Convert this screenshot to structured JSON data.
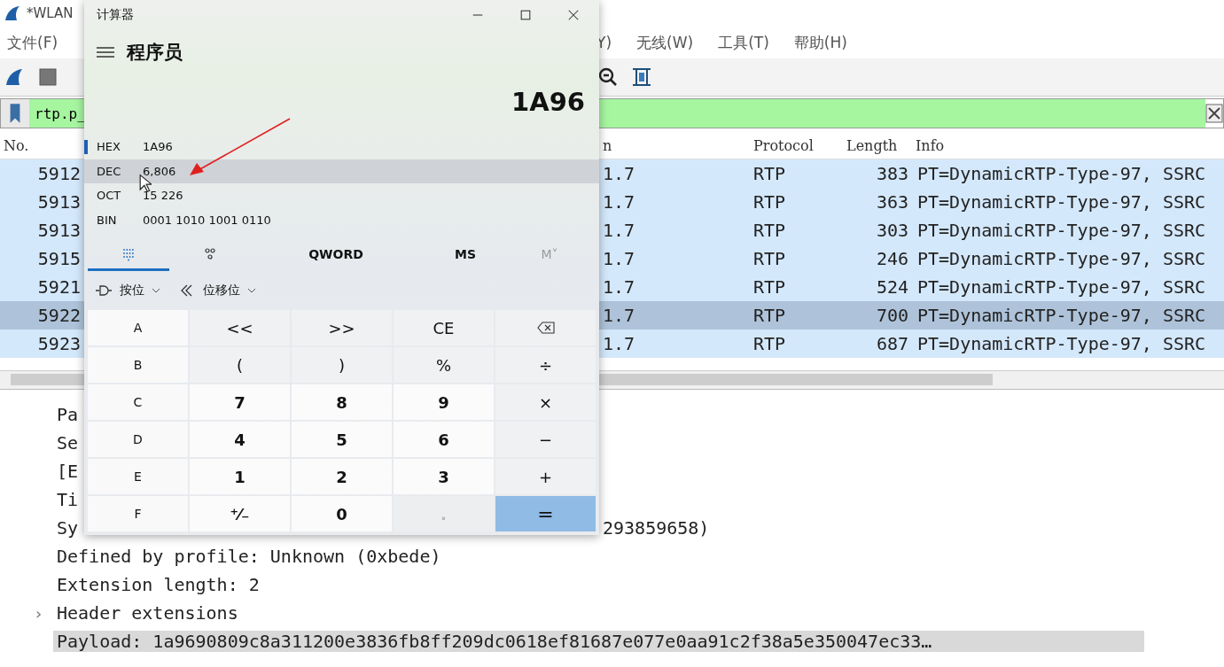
{
  "wireshark": {
    "title": "*WLAN",
    "menu_left": [
      "文件(F)"
    ],
    "menu_right": [
      "Y)",
      "无线(W)",
      "工具(T)",
      "帮助(H)"
    ],
    "filter": {
      "value": "rtp.p_"
    },
    "columns": {
      "no": "No.",
      "dest": "n",
      "protocol": "Protocol",
      "length": "Length",
      "info": "Info"
    },
    "rows": [
      {
        "no": "5912",
        "dest": "1.7",
        "protocol": "RTP",
        "length": "383",
        "info": "PT=DynamicRTP-Type-97, SSRC",
        "selected": false
      },
      {
        "no": "5913",
        "dest": "1.7",
        "protocol": "RTP",
        "length": "363",
        "info": "PT=DynamicRTP-Type-97, SSRC",
        "selected": false
      },
      {
        "no": "5913",
        "dest": "1.7",
        "protocol": "RTP",
        "length": "303",
        "info": "PT=DynamicRTP-Type-97, SSRC",
        "selected": false
      },
      {
        "no": "5915",
        "dest": "1.7",
        "protocol": "RTP",
        "length": "246",
        "info": "PT=DynamicRTP-Type-97, SSRC",
        "selected": false
      },
      {
        "no": "5921",
        "dest": "1.7",
        "protocol": "RTP",
        "length": "524",
        "info": "PT=DynamicRTP-Type-97, SSRC",
        "selected": false
      },
      {
        "no": "5922",
        "dest": "1.7",
        "protocol": "RTP",
        "length": "700",
        "info": "PT=DynamicRTP-Type-97, SSRC",
        "selected": true
      },
      {
        "no": "5923",
        "dest": "1.7",
        "protocol": "RTP",
        "length": "687",
        "info": "PT=DynamicRTP-Type-97, SSRC",
        "selected": false
      }
    ],
    "details": [
      {
        "text": "Pa",
        "selected": false
      },
      {
        "text": "Se",
        "selected": false
      },
      {
        "text": "[E",
        "selected": false
      },
      {
        "text": "Ti",
        "selected": false
      },
      {
        "text": "Sy",
        "tail": "293859658)",
        "selected": false
      },
      {
        "text": "Defined by profile: Unknown (0xbede)",
        "selected": false
      },
      {
        "text": "Extension length: 2",
        "selected": false
      },
      {
        "text": "Header extensions",
        "expander": "›",
        "selected": false
      },
      {
        "text": "Payload: 1a9690809c8a311200e3836fb8ff209dc0618ef81687e077e0aa91c2f38a5e350047ec33…",
        "selected": true
      }
    ]
  },
  "calculator": {
    "title": "计算器",
    "mode": "程序员",
    "display": "1A96",
    "radix": [
      {
        "label": "HEX",
        "value": "1A96",
        "selected": true,
        "hovered": false
      },
      {
        "label": "DEC",
        "value": "6,806",
        "selected": false,
        "hovered": true
      },
      {
        "label": "OCT",
        "value": "15 226",
        "selected": false,
        "hovered": false
      },
      {
        "label": "BIN",
        "value": "0001 1010 1001 0110",
        "selected": false,
        "hovered": false
      }
    ],
    "tabs": [
      {
        "kind": "keypad",
        "selected": true,
        "disabled": false
      },
      {
        "kind": "bits",
        "selected": false,
        "disabled": false
      },
      {
        "kind": "text",
        "label": "QWORD",
        "selected": false,
        "disabled": false
      },
      {
        "kind": "text",
        "label": "MS",
        "selected": false,
        "disabled": false
      },
      {
        "kind": "text",
        "label": "M˅",
        "selected": false,
        "disabled": true
      }
    ],
    "dropdowns": [
      {
        "kind": "bitwise",
        "label": "按位"
      },
      {
        "kind": "shift",
        "label": "位移位"
      }
    ],
    "keys": [
      {
        "label": "A",
        "kind": "hex",
        "disabled": false
      },
      {
        "label": "<<",
        "kind": "op",
        "disabled": false
      },
      {
        "label": ">>",
        "kind": "op",
        "disabled": false
      },
      {
        "label": "CE",
        "kind": "op",
        "disabled": false
      },
      {
        "kind": "backspace",
        "disabled": false
      },
      {
        "label": "B",
        "kind": "hex",
        "disabled": false
      },
      {
        "label": "(",
        "kind": "op",
        "disabled": false
      },
      {
        "label": ")",
        "kind": "op",
        "disabled": false
      },
      {
        "label": "%",
        "kind": "op",
        "disabled": false
      },
      {
        "label": "÷",
        "kind": "op",
        "disabled": false
      },
      {
        "label": "C",
        "kind": "hex",
        "disabled": false
      },
      {
        "label": "7",
        "kind": "digit",
        "disabled": false
      },
      {
        "label": "8",
        "kind": "digit",
        "disabled": false
      },
      {
        "label": "9",
        "kind": "digit",
        "disabled": false
      },
      {
        "label": "×",
        "kind": "op",
        "disabled": false
      },
      {
        "label": "D",
        "kind": "hex",
        "disabled": false
      },
      {
        "label": "4",
        "kind": "digit",
        "disabled": false
      },
      {
        "label": "5",
        "kind": "digit",
        "disabled": false
      },
      {
        "label": "6",
        "kind": "digit",
        "disabled": false
      },
      {
        "label": "−",
        "kind": "op",
        "disabled": false
      },
      {
        "label": "E",
        "kind": "hex",
        "disabled": false
      },
      {
        "label": "1",
        "kind": "digit",
        "disabled": false
      },
      {
        "label": "2",
        "kind": "digit",
        "disabled": false
      },
      {
        "label": "3",
        "kind": "digit",
        "disabled": false
      },
      {
        "label": "+",
        "kind": "op",
        "disabled": false
      },
      {
        "label": "F",
        "kind": "hex",
        "disabled": false
      },
      {
        "label": "⁺⁄₋",
        "kind": "digit",
        "disabled": false
      },
      {
        "label": "0",
        "kind": "digit",
        "disabled": false
      },
      {
        "label": ".",
        "kind": "digit",
        "disabled": true
      },
      {
        "label": "=",
        "kind": "equals",
        "disabled": false
      }
    ]
  }
}
